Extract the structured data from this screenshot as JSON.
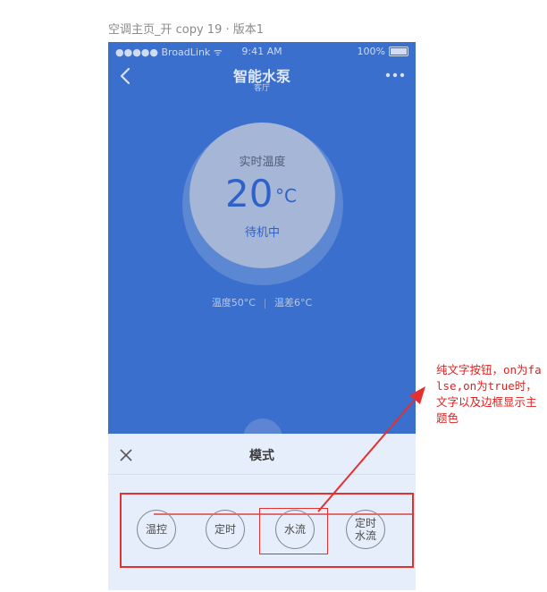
{
  "artboard": {
    "title": "空调主页_开 copy 19 · 版本1"
  },
  "status_bar": {
    "carrier": "●●●●● BroadLink ᯤ",
    "time": "9:41 AM",
    "battery": "100%"
  },
  "nav": {
    "title": "智能水泵",
    "subtitle": "客厅",
    "back_icon": "chevron-left-icon",
    "more_icon": "more-horizontal-icon"
  },
  "dial": {
    "label": "实时温度",
    "value": "20",
    "unit": "°C",
    "status": "待机中"
  },
  "readouts": {
    "temp": "温度50°C",
    "diff": "温差6°C"
  },
  "sheet": {
    "title": "模式",
    "close_icon": "close-icon",
    "buttons": [
      {
        "label": "温控",
        "on": false
      },
      {
        "label": "定时",
        "on": false
      },
      {
        "label": "水流",
        "on": false
      },
      {
        "label": "定时\n水流",
        "on": false
      }
    ]
  },
  "annotation": {
    "note": "纯文字按钮，on为false,on为true时，文字以及边框显示主题色",
    "color": "#e53030"
  },
  "colors": {
    "theme_blue": "#3a6fcd",
    "accent": "#2f62c9",
    "sheet_bg": "#e6eefb"
  }
}
